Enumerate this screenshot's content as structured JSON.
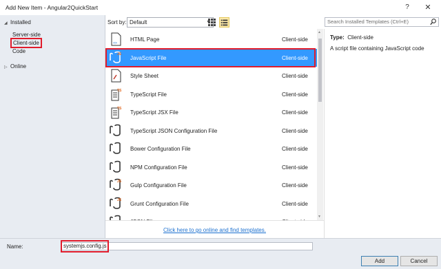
{
  "window": {
    "title": "Add New Item - Angular2QuickStart",
    "help_glyph": "?",
    "close_glyph": "✕"
  },
  "sidebar": {
    "installed_label": "Installed",
    "items": [
      {
        "label": "Server-side"
      },
      {
        "label": "Client-side",
        "selected": true
      },
      {
        "label": "Code"
      }
    ],
    "online_label": "Online"
  },
  "sortbar": {
    "sort_label": "Sort by:",
    "sort_value": "Default"
  },
  "search": {
    "placeholder": "Search Installed Templates (Ctrl+E)"
  },
  "templates": [
    {
      "name": "HTML Page",
      "category": "Client-side",
      "icon": "html-page-icon"
    },
    {
      "name": "JavaScript File",
      "category": "Client-side",
      "icon": "javascript-file-icon",
      "selected": true
    },
    {
      "name": "Style Sheet",
      "category": "Client-side",
      "icon": "style-sheet-icon"
    },
    {
      "name": "TypeScript File",
      "category": "Client-side",
      "icon": "typescript-file-icon"
    },
    {
      "name": "TypeScript JSX File",
      "category": "Client-side",
      "icon": "typescript-jsx-file-icon"
    },
    {
      "name": "TypeScript JSON Configuration File",
      "category": "Client-side",
      "icon": "json-config-icon"
    },
    {
      "name": "Bower Configuration File",
      "category": "Client-side",
      "icon": "json-config-icon"
    },
    {
      "name": "NPM Configuration File",
      "category": "Client-side",
      "icon": "json-config-icon"
    },
    {
      "name": "Gulp Configuration File",
      "category": "Client-side",
      "icon": "javascript-config-icon"
    },
    {
      "name": "Grunt Configuration File",
      "category": "Client-side",
      "icon": "javascript-config-icon"
    },
    {
      "name": "JSON File",
      "category": "Client-side",
      "icon": "json-config-icon"
    }
  ],
  "online_link": "Click here to go online and find templates.",
  "details": {
    "type_label": "Type:",
    "type_value": "Client-side",
    "description": "A script file containing JavaScript code"
  },
  "name_field": {
    "label": "Name:",
    "value": "systemjs.config.js"
  },
  "buttons": {
    "add": "Add",
    "cancel": "Cancel"
  },
  "colors": {
    "selection": "#3399ff",
    "annotation_highlight": "#e01b2b",
    "link": "#1a6fcf"
  }
}
